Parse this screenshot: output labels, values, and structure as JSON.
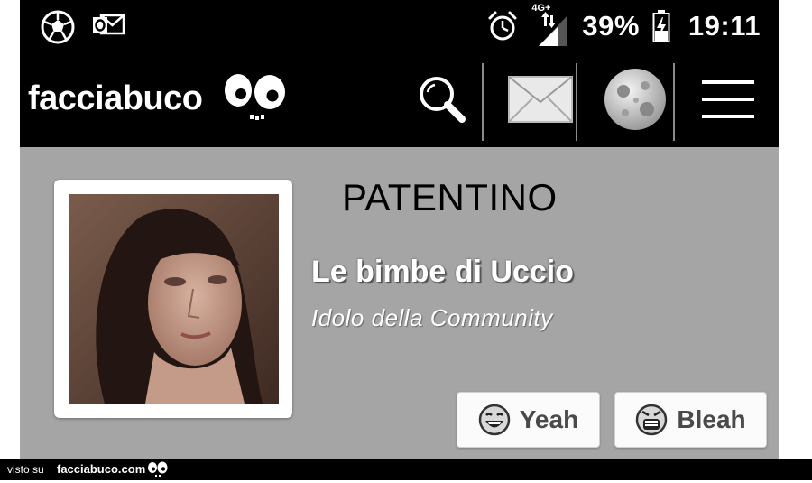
{
  "status_bar": {
    "left_icons": [
      "soccer-ball-icon",
      "outlook-notification-icon"
    ],
    "network_label": "4G+",
    "battery_percent": "39%",
    "time": "19:11",
    "battery_level": 0.39
  },
  "header": {
    "logo_text": "facciabuco",
    "icons": [
      "search-icon",
      "mail-icon",
      "moon-avatar-icon",
      "menu-icon"
    ]
  },
  "profile": {
    "card_title": "PATENTINO",
    "name": "Le bimbe di Uccio",
    "rank": "Idolo della Community"
  },
  "actions": {
    "yeah_label": "Yeah",
    "bleah_label": "Bleah"
  },
  "credit": {
    "prefix": "visto su",
    "site": "facciabuco.com"
  }
}
